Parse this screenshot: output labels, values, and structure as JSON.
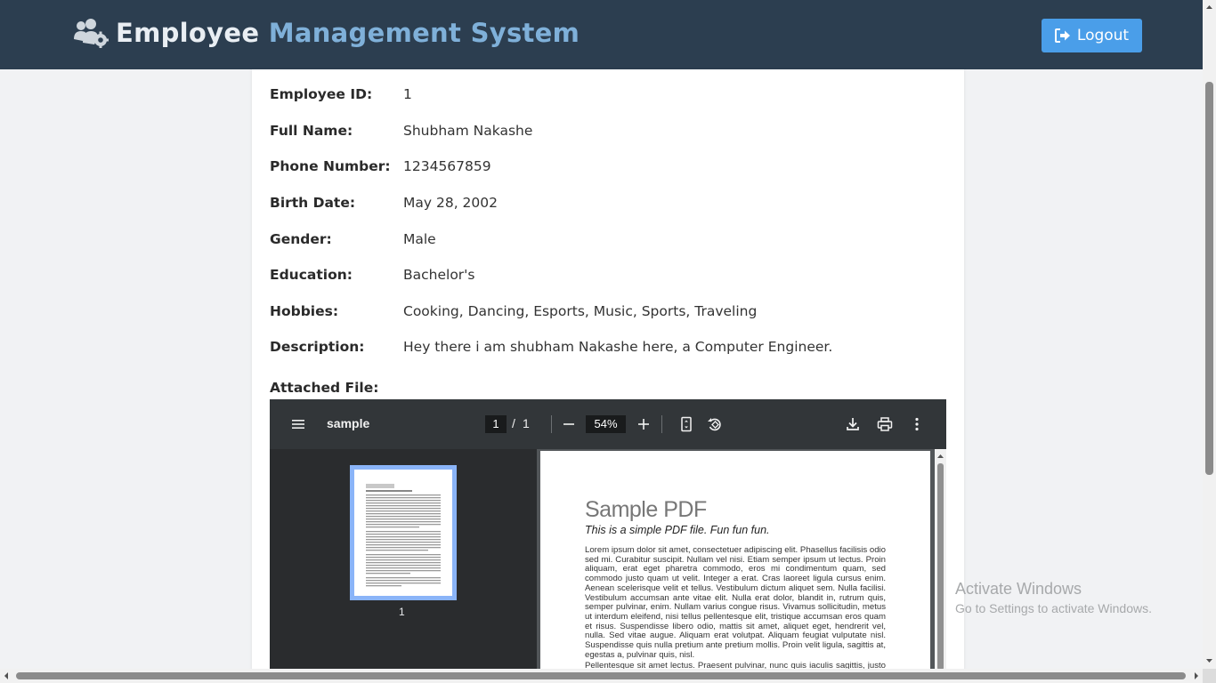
{
  "header": {
    "title_part1": "Employee",
    "title_part2": "Management System",
    "logout_label": "Logout",
    "brand_icon": "users-cog-icon",
    "logout_icon": "sign-out-icon"
  },
  "employee": {
    "fields": [
      {
        "label": "Employee ID:",
        "value": "1"
      },
      {
        "label": "Full Name:",
        "value": "Shubham Nakashe"
      },
      {
        "label": "Phone Number:",
        "value": "1234567859"
      },
      {
        "label": "Birth Date:",
        "value": "May 28, 2002"
      },
      {
        "label": "Gender:",
        "value": "Male"
      },
      {
        "label": "Education:",
        "value": "Bachelor's"
      },
      {
        "label": "Hobbies:",
        "value": "Cooking, Dancing, Esports, Music, Sports, Traveling"
      },
      {
        "label": "Description:",
        "value": "Hey there i am shubham Nakashe here, a Computer Engineer."
      }
    ],
    "attached_label": "Attached File:"
  },
  "pdf_viewer": {
    "file_name": "sample",
    "current_page": "1",
    "page_separator": "/",
    "total_pages": "1",
    "zoom": "54%",
    "thumbnail_label": "1",
    "page": {
      "heading": "Sample PDF",
      "subtitle": "This is a simple PDF file. Fun fun fun.",
      "paragraph1": "Lorem ipsum dolor sit amet, consectetuer adipiscing elit. Phasellus facilisis odio sed mi. Curabitur suscipit. Nullam vel nisi. Etiam semper ipsum ut lectus. Proin aliquam, erat eget pharetra commodo, eros mi condimentum quam, sed commodo justo quam ut velit. Integer a erat. Cras laoreet ligula cursus enim. Aenean scelerisque velit et tellus. Vestibulum dictum aliquet sem. Nulla facilisi. Vestibulum accumsan ante vitae elit. Nulla erat dolor, blandit in, rutrum quis, semper pulvinar, enim. Nullam varius congue risus. Vivamus sollicitudin, metus ut interdum eleifend, nisi tellus pellentesque elit, tristique accumsan eros quam et risus. Suspendisse libero odio, mattis sit amet, aliquet eget, hendrerit vel, nulla. Sed vitae augue. Aliquam erat volutpat. Aliquam feugiat vulputate nisl. Suspendisse quis nulla pretium ante pretium mollis. Proin velit ligula, sagittis at, egestas a, pulvinar quis, nisl.",
      "paragraph2": "Pellentesque sit amet lectus. Praesent pulvinar, nunc quis iaculis sagittis, justo quam"
    },
    "icons": [
      "menu-icon",
      "zoom-out-icon",
      "zoom-in-icon",
      "fit-page-icon",
      "rotate-icon",
      "download-icon",
      "print-icon",
      "more-options-icon"
    ]
  },
  "watermark": {
    "line1": "Activate Windows",
    "line2": "Go to Settings to activate Windows."
  },
  "colors": {
    "header_bg": "#2c3e50",
    "title_accent": "#7fb0d9",
    "logout_bg": "#4a9ee9",
    "pdf_toolbar_bg": "#323639",
    "thumb_highlight": "#8ab4f8"
  }
}
